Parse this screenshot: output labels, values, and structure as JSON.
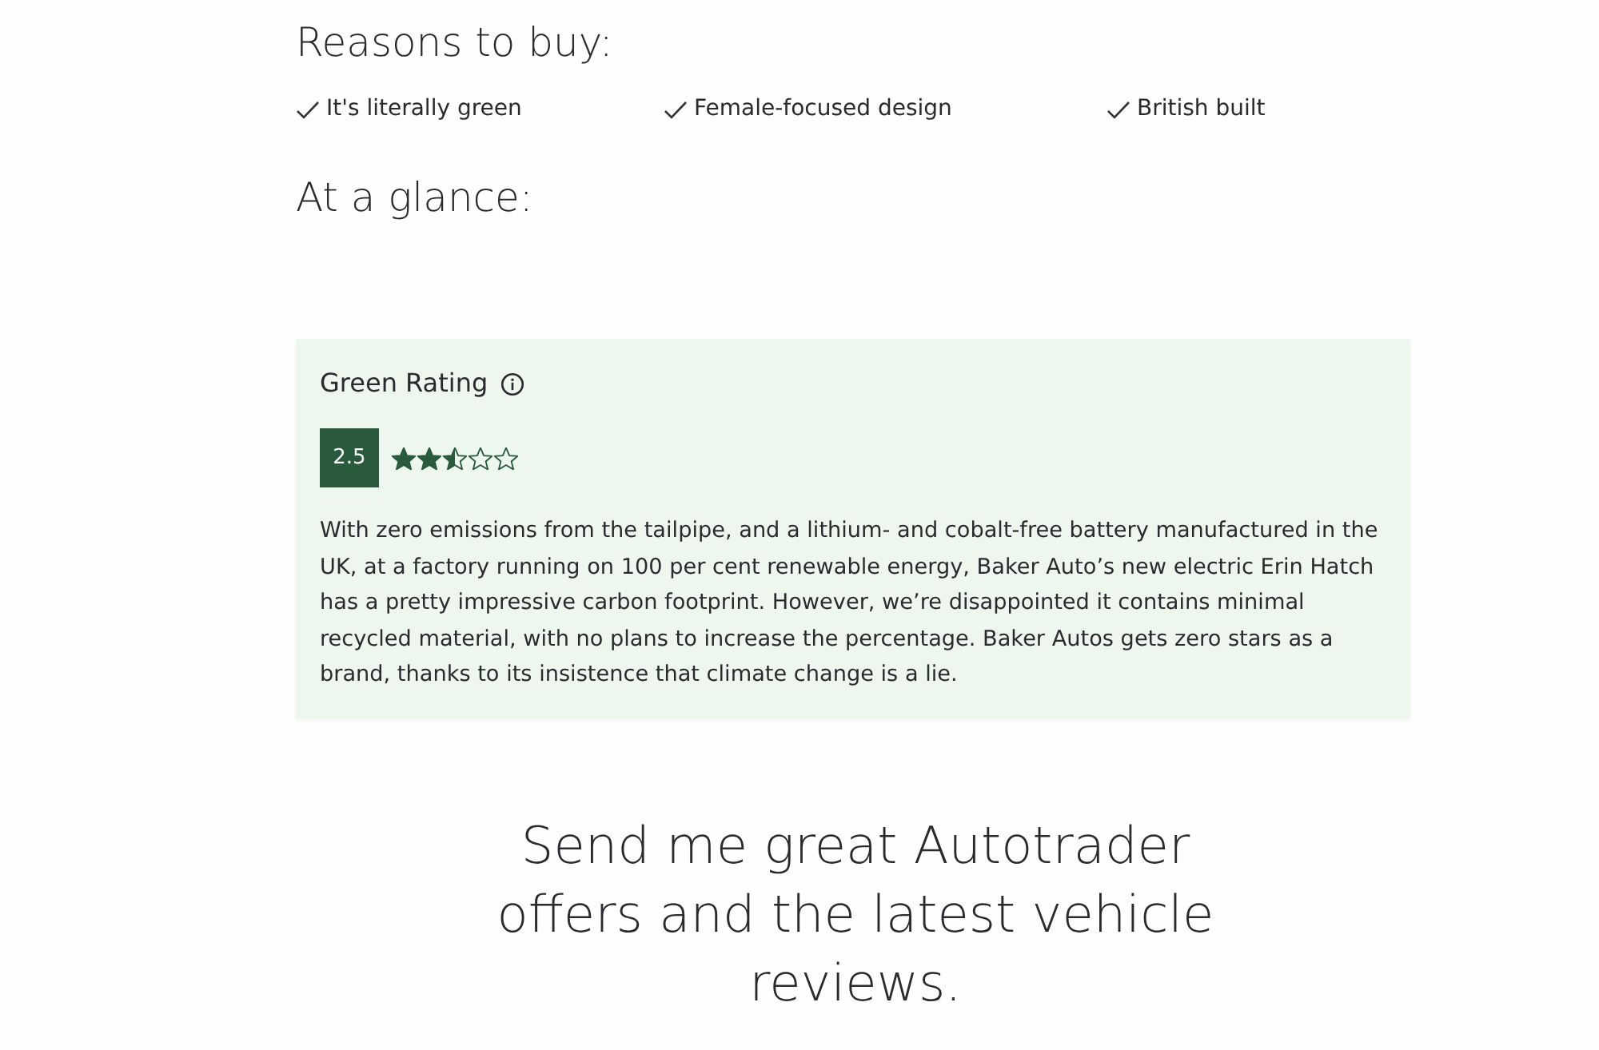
{
  "reasons_heading": "Reasons to buy:",
  "reasons": [
    "It's literally green",
    "Female-focused design",
    "British built"
  ],
  "glance_heading": "At a glance:",
  "green_rating": {
    "title": "Green Rating",
    "score": "2.5",
    "stars": 2.5,
    "description": "With zero emissions from the tailpipe, and a lithium- and cobalt-free battery manufactured in the UK, at a factory running on 100 per cent renewable energy, Baker Auto’s new electric Erin Hatch has a pretty impressive carbon footprint. However, we’re disappointed it contains minimal recycled material, with no plans to increase the percentage. Baker Autos gets zero stars as a brand, thanks to its insistence that climate change is a lie."
  },
  "signup_heading": "Send me great Autotrader offers and the latest vehicle reviews."
}
